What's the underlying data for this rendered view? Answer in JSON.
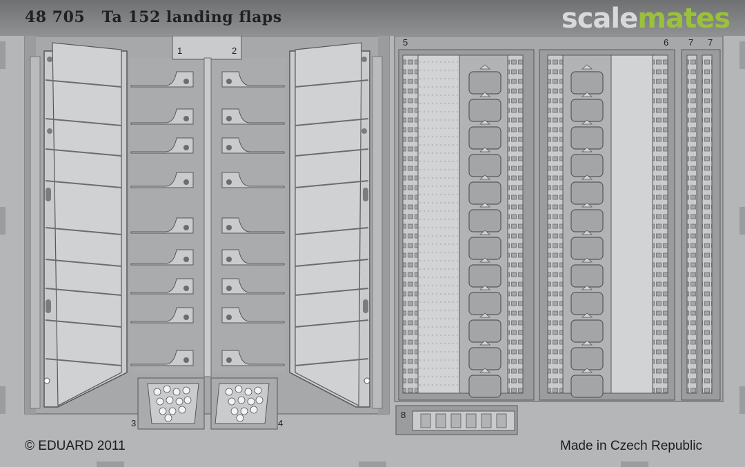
{
  "header": {
    "title": "48 705   Ta 152 landing flaps",
    "logo_part1": "scale",
    "logo_part2": "mates"
  },
  "part_numbers": {
    "p1": "1",
    "p2": "2",
    "p3": "3",
    "p4": "4",
    "p5": "5",
    "p6": "6",
    "p7a": "7",
    "p7b": "7",
    "p8": "8"
  },
  "footer": {
    "copyright": "© EDUARD 2011",
    "made_in": "Made in Czech Republic"
  },
  "colors": {
    "background": "#b4b6b8",
    "fret": "#9fa1a3",
    "part_light": "#c9cbcd",
    "part_line": "#55585a",
    "logo_accent": "#9bc13c"
  }
}
